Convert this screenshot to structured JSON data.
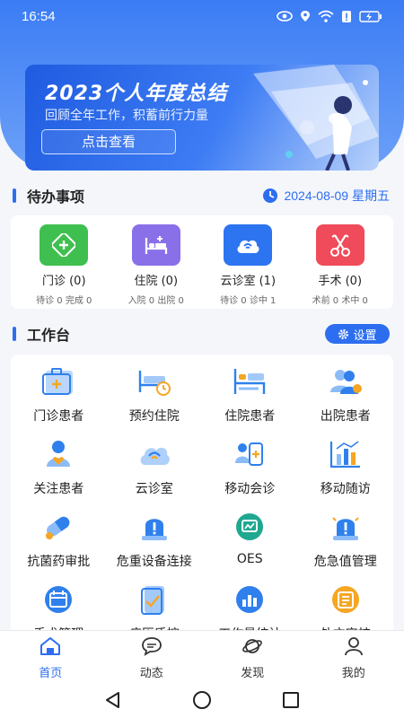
{
  "status": {
    "time": "16:54"
  },
  "banner": {
    "title": "2023个人年度总结",
    "subtitle": "回顾全年工作，积蓄前行力量",
    "button": "点击查看"
  },
  "todo": {
    "title": "待办事项",
    "date": "2024-08-09 星期五",
    "items": [
      {
        "name": "门诊 (0)",
        "sub": "待诊 0 完成 0",
        "icon": "outpatient-icon",
        "color": "#3fbf4f"
      },
      {
        "name": "住院 (0)",
        "sub": "入院 0 出院 0",
        "icon": "hospital-bed-icon",
        "color": "#8a70e8"
      },
      {
        "name": "云诊室 (1)",
        "sub": "待诊 0 诊中 1",
        "icon": "cloud-clinic-icon",
        "color": "#2d74f0"
      },
      {
        "name": "手术 (0)",
        "sub": "术前 0 术中 0",
        "icon": "surgery-scissors-icon",
        "color": "#f04b5a"
      }
    ]
  },
  "workbench": {
    "title": "工作台",
    "settings": "设置",
    "items": [
      {
        "name": "门诊患者",
        "icon": "outpatient-case-icon"
      },
      {
        "name": "预约住院",
        "icon": "appointment-bed-icon"
      },
      {
        "name": "住院患者",
        "icon": "inpatient-bed-icon"
      },
      {
        "name": "出院患者",
        "icon": "discharge-patients-icon"
      },
      {
        "name": "关注患者",
        "icon": "followed-patient-icon"
      },
      {
        "name": "云诊室",
        "icon": "cloud-clinic-icon"
      },
      {
        "name": "移动会诊",
        "icon": "mobile-consult-icon"
      },
      {
        "name": "移动随访",
        "icon": "followup-chart-icon"
      },
      {
        "name": "抗菌药审批",
        "icon": "pill-icon"
      },
      {
        "name": "危重设备连接",
        "icon": "alarm-device-icon"
      },
      {
        "name": "OES",
        "icon": "oes-icon"
      },
      {
        "name": "危急值管理",
        "icon": "critical-alarm-icon"
      },
      {
        "name": "手术管理",
        "icon": "surgery-calendar-icon"
      },
      {
        "name": "病历质控",
        "icon": "record-check-icon"
      },
      {
        "name": "工作量统计",
        "icon": "stats-chart-icon"
      },
      {
        "name": "处方审核",
        "icon": "prescription-icon"
      }
    ]
  },
  "tabs": [
    {
      "label": "首页",
      "icon": "home-icon",
      "active": true
    },
    {
      "label": "动态",
      "icon": "chat-bubble-icon",
      "active": false
    },
    {
      "label": "发现",
      "icon": "planet-icon",
      "active": false
    },
    {
      "label": "我的",
      "icon": "user-icon",
      "active": false
    }
  ],
  "colors": {
    "primary": "#2d6ef0",
    "hero": "#3b7cf5"
  }
}
